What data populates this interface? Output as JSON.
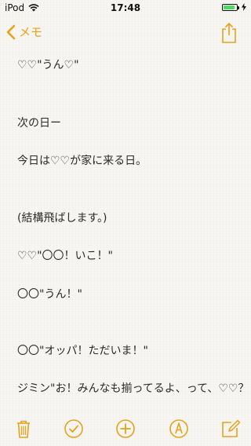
{
  "status_bar": {
    "carrier": "iPod",
    "time": "17:48",
    "battery_fill_fraction": 0.9,
    "battery_color": "#4cd964"
  },
  "nav": {
    "back_label": "メモ",
    "accent_color": "#e6a21a"
  },
  "note": {
    "lines": [
      "♡♡\"うん♡\"",
      "次の日ー",
      "今日は♡♡が家に来る日。",
      "(結構飛ばします。)",
      "♡♡\"〇〇！いこ！\"",
      "〇〇\"うん！\"",
      "〇〇\"オッパ！ただいま！\"",
      "ジミン\"お！みんなも揃ってるよ、って、♡♡？！\""
    ]
  },
  "toolbar": {
    "icons": [
      "trash-icon",
      "checklist-icon",
      "add-icon",
      "markup-icon",
      "compose-icon"
    ]
  }
}
